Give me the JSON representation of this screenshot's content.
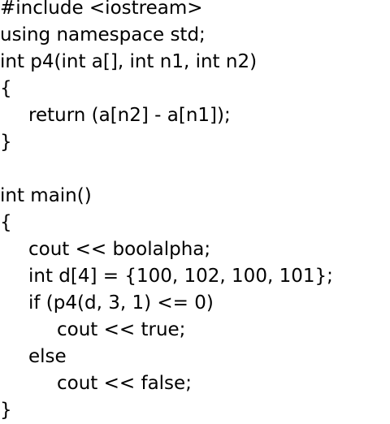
{
  "code": {
    "lines": [
      {
        "text": "#include <iostream>",
        "indent": 0
      },
      {
        "text": "using namespace std;",
        "indent": 0
      },
      {
        "text": "int p4(int a[], int n1, int n2)",
        "indent": 0
      },
      {
        "text": "{",
        "indent": 0
      },
      {
        "text": "return (a[n2] - a[n1]);",
        "indent": 1
      },
      {
        "text": "}",
        "indent": 0
      },
      {
        "text": "",
        "indent": 0
      },
      {
        "text": "int main()",
        "indent": 0
      },
      {
        "text": "{",
        "indent": 0
      },
      {
        "text": "cout << boolalpha;",
        "indent": 1
      },
      {
        "text": "int d[4] = {100, 102, 100, 101};",
        "indent": 1
      },
      {
        "text": "if (p4(d, 3, 1) <= 0)",
        "indent": 1
      },
      {
        "text": "cout << true;",
        "indent": 2
      },
      {
        "text": "else",
        "indent": 1
      },
      {
        "text": "cout << false;",
        "indent": 2
      },
      {
        "text": "}",
        "indent": 0
      }
    ],
    "text_color": "#000000",
    "background_color": "#ffffff"
  }
}
